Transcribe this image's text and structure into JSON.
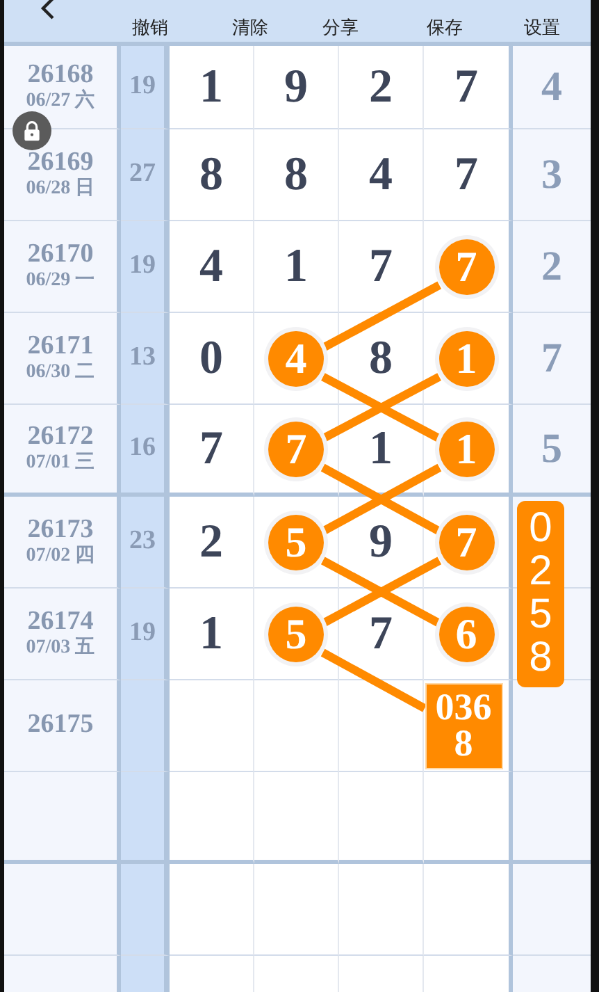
{
  "toolbar": {
    "buttons": [
      "撤销",
      "清除",
      "分享",
      "保存",
      "设置"
    ]
  },
  "rows": [
    {
      "issue": "26168",
      "date": "06/27 六",
      "sum": "19",
      "cells": [
        {
          "kind": "digit",
          "value": "1",
          "highlighted": false
        },
        {
          "kind": "digit",
          "value": "9",
          "highlighted": false
        },
        {
          "kind": "digit",
          "value": "2",
          "highlighted": false
        },
        {
          "kind": "digit",
          "value": "7",
          "highlighted": false
        }
      ],
      "tail": {
        "kind": "digit",
        "value": "4"
      }
    },
    {
      "issue": "26169",
      "date": "06/28 日",
      "sum": "27",
      "cells": [
        {
          "kind": "digit",
          "value": "8",
          "highlighted": false
        },
        {
          "kind": "digit",
          "value": "8",
          "highlighted": false
        },
        {
          "kind": "digit",
          "value": "4",
          "highlighted": false
        },
        {
          "kind": "digit",
          "value": "7",
          "highlighted": false
        }
      ],
      "tail": {
        "kind": "digit",
        "value": "3"
      }
    },
    {
      "issue": "26170",
      "date": "06/29 一",
      "sum": "19",
      "cells": [
        {
          "kind": "digit",
          "value": "4",
          "highlighted": false
        },
        {
          "kind": "digit",
          "value": "1",
          "highlighted": false
        },
        {
          "kind": "digit",
          "value": "7",
          "highlighted": false
        },
        {
          "kind": "digit",
          "value": "7",
          "highlighted": true
        }
      ],
      "tail": {
        "kind": "digit",
        "value": "2"
      }
    },
    {
      "issue": "26171",
      "date": "06/30 二",
      "sum": "13",
      "cells": [
        {
          "kind": "digit",
          "value": "0",
          "highlighted": false
        },
        {
          "kind": "digit",
          "value": "4",
          "highlighted": true
        },
        {
          "kind": "digit",
          "value": "8",
          "highlighted": false
        },
        {
          "kind": "digit",
          "value": "1",
          "highlighted": true
        }
      ],
      "tail": {
        "kind": "digit",
        "value": "7"
      }
    },
    {
      "issue": "26172",
      "date": "07/01 三",
      "sum": "16",
      "cells": [
        {
          "kind": "digit",
          "value": "7",
          "highlighted": false
        },
        {
          "kind": "digit",
          "value": "7",
          "highlighted": true
        },
        {
          "kind": "digit",
          "value": "1",
          "highlighted": false
        },
        {
          "kind": "digit",
          "value": "1",
          "highlighted": true
        }
      ],
      "tail": {
        "kind": "digit",
        "value": "5"
      }
    },
    {
      "issue": "26173",
      "date": "07/02 四",
      "sum": "23",
      "cells": [
        {
          "kind": "digit",
          "value": "2",
          "highlighted": false
        },
        {
          "kind": "digit",
          "value": "5",
          "highlighted": true
        },
        {
          "kind": "digit",
          "value": "9",
          "highlighted": false
        },
        {
          "kind": "digit",
          "value": "7",
          "highlighted": true
        }
      ],
      "tail": {
        "kind": "prediction",
        "value": "0258"
      }
    },
    {
      "issue": "26174",
      "date": "07/03 五",
      "sum": "19",
      "cells": [
        {
          "kind": "digit",
          "value": "1",
          "highlighted": false
        },
        {
          "kind": "digit",
          "value": "5",
          "highlighted": true
        },
        {
          "kind": "digit",
          "value": "7",
          "highlighted": false
        },
        {
          "kind": "digit",
          "value": "6",
          "highlighted": true
        }
      ]
    },
    {
      "issue": "26175",
      "cells": [
        {
          "kind": "empty"
        },
        {
          "kind": "empty"
        },
        {
          "kind": "empty"
        },
        {
          "kind": "prediction",
          "value": "0368"
        }
      ]
    }
  ]
}
